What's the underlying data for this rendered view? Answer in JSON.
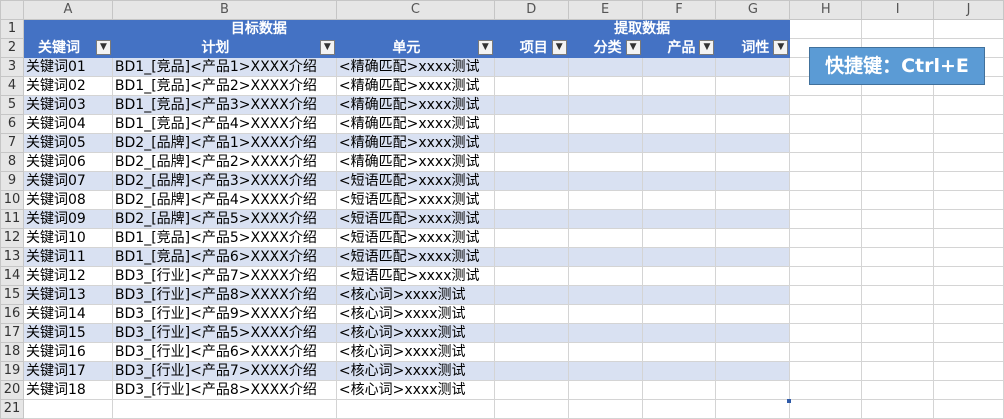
{
  "columns": [
    "A",
    "B",
    "C",
    "D",
    "E",
    "F",
    "G",
    "H",
    "I",
    "J"
  ],
  "band_headers": {
    "target": "目标数据",
    "extract": "提取数据"
  },
  "headers": [
    "关键词",
    "计划",
    "单元",
    "项目",
    "分类",
    "产品",
    "词性"
  ],
  "rows": [
    {
      "num": "1"
    },
    {
      "num": "2"
    },
    {
      "num": "3",
      "keyword": "关键词01",
      "plan": "BD1_[竞品]<产品1>XXXX介绍",
      "unit": "<精确匹配>xxxx测试"
    },
    {
      "num": "4",
      "keyword": "关键词02",
      "plan": "BD1_[竞品]<产品2>XXXX介绍",
      "unit": "<精确匹配>xxxx测试"
    },
    {
      "num": "5",
      "keyword": "关键词03",
      "plan": "BD1_[竞品]<产品3>XXXX介绍",
      "unit": "<精确匹配>xxxx测试"
    },
    {
      "num": "6",
      "keyword": "关键词04",
      "plan": "BD1_[竞品]<产品4>XXXX介绍",
      "unit": "<精确匹配>xxxx测试"
    },
    {
      "num": "7",
      "keyword": "关键词05",
      "plan": "BD2_[品牌]<产品1>XXXX介绍",
      "unit": "<精确匹配>xxxx测试"
    },
    {
      "num": "8",
      "keyword": "关键词06",
      "plan": "BD2_[品牌]<产品2>XXXX介绍",
      "unit": "<精确匹配>xxxx测试"
    },
    {
      "num": "9",
      "keyword": "关键词07",
      "plan": "BD2_[品牌]<产品3>XXXX介绍",
      "unit": "<短语匹配>xxxx测试"
    },
    {
      "num": "10",
      "keyword": "关键词08",
      "plan": "BD2_[品牌]<产品4>XXXX介绍",
      "unit": "<短语匹配>xxxx测试"
    },
    {
      "num": "11",
      "keyword": "关键词09",
      "plan": "BD2_[品牌]<产品5>XXXX介绍",
      "unit": "<短语匹配>xxxx测试"
    },
    {
      "num": "12",
      "keyword": "关键词10",
      "plan": "BD1_[竞品]<产品5>XXXX介绍",
      "unit": "<短语匹配>xxxx测试"
    },
    {
      "num": "13",
      "keyword": "关键词11",
      "plan": "BD1_[竞品]<产品6>XXXX介绍",
      "unit": "<短语匹配>xxxx测试"
    },
    {
      "num": "14",
      "keyword": "关键词12",
      "plan": "BD3_[行业]<产品7>XXXX介绍",
      "unit": "<短语匹配>xxxx测试"
    },
    {
      "num": "15",
      "keyword": "关键词13",
      "plan": "BD3_[行业]<产品8>XXXX介绍",
      "unit": "<核心词>xxxx测试"
    },
    {
      "num": "16",
      "keyword": "关键词14",
      "plan": "BD3_[行业]<产品9>XXXX介绍",
      "unit": "<核心词>xxxx测试"
    },
    {
      "num": "17",
      "keyword": "关键词15",
      "plan": "BD3_[行业]<产品5>XXXX介绍",
      "unit": "<核心词>xxxx测试"
    },
    {
      "num": "18",
      "keyword": "关键词16",
      "plan": "BD3_[行业]<产品6>XXXX介绍",
      "unit": "<核心词>xxxx测试"
    },
    {
      "num": "19",
      "keyword": "关键词17",
      "plan": "BD3_[行业]<产品7>XXXX介绍",
      "unit": "<核心词>xxxx测试"
    },
    {
      "num": "20",
      "keyword": "关键词18",
      "plan": "BD3_[行业]<产品8>XXXX介绍",
      "unit": "<核心词>xxxx测试"
    },
    {
      "num": "21"
    }
  ],
  "shortcut_box": "快捷键：Ctrl+E",
  "icons": {
    "filter": "filter-dropdown-icon"
  },
  "colors": {
    "header_blue": "#4472c4",
    "band_light": "#d9e1f2",
    "callout_blue": "#5b9bd5"
  }
}
